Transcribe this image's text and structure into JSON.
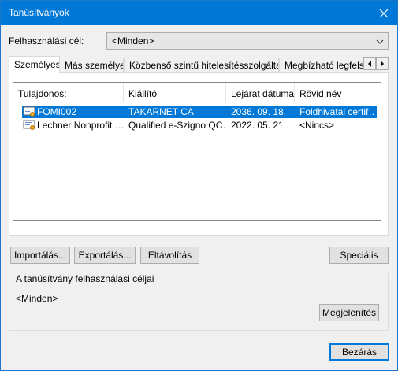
{
  "window": {
    "title": "Tanúsítványok"
  },
  "purpose": {
    "label": "Felhasználási cél:",
    "value": "<Minden>"
  },
  "tabs": [
    {
      "label": "Személyes",
      "active": true
    },
    {
      "label": "Más személyek",
      "active": false
    },
    {
      "label": "Közbenső szintű hitelesítésszolgáltatók",
      "active": false
    },
    {
      "label": "Megbízható legfelső",
      "active": false
    }
  ],
  "list": {
    "columns": [
      "Tulajdonos:",
      "Kiállító",
      "Lejárat dátuma",
      "Rövid név"
    ],
    "rows": [
      {
        "owner": "FOMI002",
        "issuer": "TAKARNET CA",
        "expires": "2036. 09. 18.",
        "short": "Foldhivatal certif…",
        "selected": true
      },
      {
        "owner": "Lechner Nonprofit …",
        "issuer": "Qualified e-Szigno QC…",
        "expires": "2022. 05. 21.",
        "short": "<Nincs>",
        "selected": false
      }
    ]
  },
  "buttons": {
    "import": "Importálás...",
    "export": "Exportálás...",
    "remove": "Eltávolítás",
    "advanced": "Speciális",
    "view": "Megjelenítés",
    "close": "Bezárás"
  },
  "purposes_group": {
    "title": "A tanúsítvány felhasználási céljai",
    "value": "<Minden>"
  },
  "colors": {
    "titlebar": "#0078d7",
    "selection": "#0078d7"
  }
}
